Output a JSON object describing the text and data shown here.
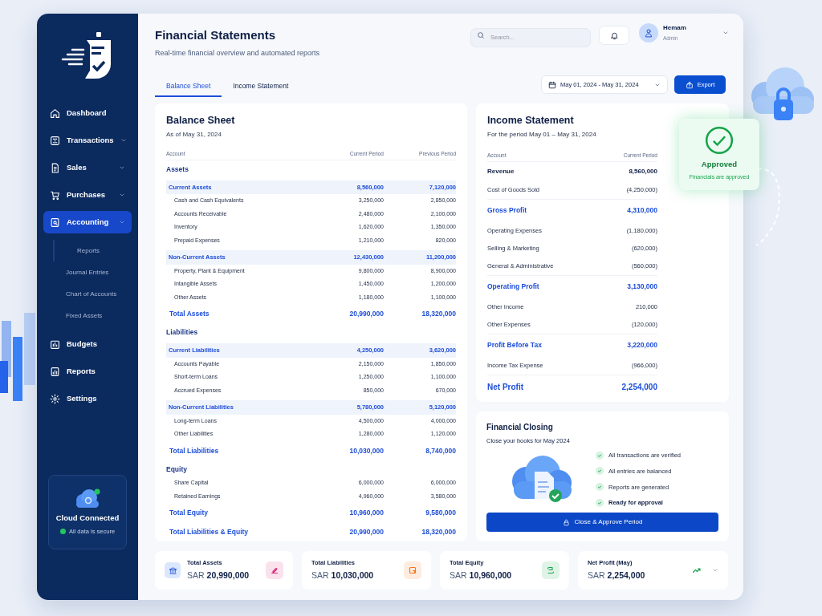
{
  "sidebar": {
    "items": [
      {
        "label": "Dashboard",
        "has_submenu": false,
        "selected": false
      },
      {
        "label": "Transactions",
        "has_submenu": true,
        "selected": false
      },
      {
        "label": "Sales",
        "has_submenu": true,
        "selected": false
      },
      {
        "label": "Purchases",
        "has_submenu": true,
        "selected": false
      },
      {
        "label": "Accounting",
        "has_submenu": true,
        "selected": true,
        "children": [
          {
            "label": "Reports",
            "selected": true
          },
          {
            "label": "Journal Entries",
            "selected": false
          },
          {
            "label": "Chart of Accounts",
            "selected": false
          },
          {
            "label": "Fixed Assets",
            "selected": false
          }
        ]
      },
      {
        "label": "Budgets",
        "has_submenu": false,
        "selected": false
      },
      {
        "label": "Reports",
        "has_submenu": false,
        "selected": false
      },
      {
        "label": "Settings",
        "has_submenu": false,
        "selected": false
      }
    ],
    "cloud": {
      "title": "Cloud Connected",
      "status": "All data is secure",
      "color": "#22c55e"
    }
  },
  "header": {
    "title": "Financial Statements",
    "subtitle": "Real-time financial overview and automated reports",
    "search": {
      "placeholder": "Search..."
    },
    "user": {
      "name": "Hemam",
      "role": "Admin"
    }
  },
  "tabs": [
    {
      "label": "Balance Sheet",
      "selected": true
    },
    {
      "label": "Income Statement",
      "selected": false
    }
  ],
  "date_range": "May 01, 2024 - May 31, 2024",
  "export_button": "Export",
  "balance_sheet": {
    "title": "Balance Sheet",
    "subtitle": "As of May 31, 2024",
    "columns": [
      "Account",
      "Current Period",
      "Previous Period"
    ],
    "rows": [
      {
        "kind": "section",
        "label": "Assets"
      },
      {
        "kind": "group",
        "label": "Current Assets",
        "current": "8,560,000",
        "previous": "7,120,000"
      },
      {
        "kind": "item",
        "label": "Cash and Cash Equivalents",
        "current": "3,250,000",
        "previous": "2,850,000"
      },
      {
        "kind": "item",
        "label": "Accounts Receivable",
        "current": "2,480,000",
        "previous": "2,100,000"
      },
      {
        "kind": "item",
        "label": "Inventory",
        "current": "1,620,000",
        "previous": "1,350,000"
      },
      {
        "kind": "item",
        "label": "Prepaid Expenses",
        "current": "1,210,000",
        "previous": "820,000"
      },
      {
        "kind": "group",
        "label": "Non-Current Assets",
        "current": "12,430,000",
        "previous": "11,200,000"
      },
      {
        "kind": "item",
        "label": "Property, Plant & Equipment",
        "current": "9,800,000",
        "previous": "8,900,000"
      },
      {
        "kind": "item",
        "label": "Intangible Assets",
        "current": "1,450,000",
        "previous": "1,200,000"
      },
      {
        "kind": "item",
        "label": "Other Assets",
        "current": "1,180,000",
        "previous": "1,100,000"
      },
      {
        "kind": "total",
        "label": "Total Assets",
        "current": "20,990,000",
        "previous": "18,320,000"
      },
      {
        "kind": "section",
        "label": "Liabilities"
      },
      {
        "kind": "group",
        "label": "Current Liabilities",
        "current": "4,250,000",
        "previous": "3,620,000"
      },
      {
        "kind": "item",
        "label": "Accounts Payable",
        "current": "2,150,000",
        "previous": "1,850,000"
      },
      {
        "kind": "item",
        "label": "Short-term Loans",
        "current": "1,250,000",
        "previous": "1,100,000"
      },
      {
        "kind": "item",
        "label": "Accrued Expenses",
        "current": "850,000",
        "previous": "670,000"
      },
      {
        "kind": "group",
        "label": "Non-Current Liabilities",
        "current": "5,780,000",
        "previous": "5,120,000"
      },
      {
        "kind": "item",
        "label": "Long-term Loans",
        "current": "4,500,000",
        "previous": "4,000,000"
      },
      {
        "kind": "item",
        "label": "Other Liabilities",
        "current": "1,280,000",
        "previous": "1,120,000"
      },
      {
        "kind": "total",
        "label": "Total Liabilities",
        "current": "10,030,000",
        "previous": "8,740,000"
      },
      {
        "kind": "section",
        "label": "Equity"
      },
      {
        "kind": "item",
        "label": "Share Capital",
        "current": "6,000,000",
        "previous": "6,000,000"
      },
      {
        "kind": "item",
        "label": "Retained Earnings",
        "current": "4,960,000",
        "previous": "3,580,000"
      },
      {
        "kind": "total",
        "label": "Total Equity",
        "current": "10,960,000",
        "previous": "9,580,000"
      },
      {
        "kind": "total",
        "label": "Total Liabilities & Equity",
        "current": "20,990,000",
        "previous": "18,320,000"
      }
    ]
  },
  "income_statement": {
    "title": "Income Statement",
    "subtitle": "For the period May 01 – May 31, 2024",
    "columns": [
      "Account",
      "Current Period"
    ],
    "rows": [
      {
        "kind": "emphasis",
        "label": "Revenue",
        "value": "8,560,000"
      },
      {
        "kind": "item",
        "label": "Cost of Goods Sold",
        "value": "(4,250,000)"
      },
      {
        "kind": "subtotal",
        "label": "Gross Profit",
        "value": "4,310,000"
      },
      {
        "kind": "item",
        "label": "Operating Expenses",
        "value": "(1,180,000)"
      },
      {
        "kind": "item",
        "label": "Selling & Marketing",
        "value": "(620,000)"
      },
      {
        "kind": "item",
        "label": "General & Administrative",
        "value": "(560,000)"
      },
      {
        "kind": "subtotal",
        "label": "Operating Profit",
        "value": "3,130,000"
      },
      {
        "kind": "item",
        "label": "Other Income",
        "value": "210,000"
      },
      {
        "kind": "item",
        "label": "Other Expenses",
        "value": "(120,000)"
      },
      {
        "kind": "subtotal",
        "label": "Profit Before Tax",
        "value": "3,220,000"
      },
      {
        "kind": "item",
        "label": "Income Tax Expense",
        "value": "(966,000)"
      },
      {
        "kind": "total",
        "label": "Net Profit",
        "value": "2,254,000"
      }
    ]
  },
  "approved": {
    "title": "Approved",
    "text": "Financials are approved"
  },
  "closing": {
    "title": "Financial Closing",
    "subtitle": "Close your books for May 2024",
    "checklist": [
      {
        "label": "All transactions are verified",
        "checked": true
      },
      {
        "label": "All entries are balanced",
        "checked": true
      },
      {
        "label": "Reports are generated",
        "checked": true
      },
      {
        "label": "Ready for approval",
        "checked": true
      }
    ],
    "button": "Close & Approve Period"
  },
  "summary": [
    {
      "label": "Total Assets",
      "currency": "SAR",
      "value": "20,990,000",
      "color": "#db2777"
    },
    {
      "label": "Total Liabilities",
      "currency": "SAR",
      "value": "10,030,000",
      "color": "#f97316"
    },
    {
      "label": "Total Equity",
      "currency": "SAR",
      "value": "10,960,000",
      "color": "#16a34a"
    },
    {
      "label": "Net Profit (May)",
      "currency": "SAR",
      "value": "2,254,000",
      "color": "#16a34a"
    }
  ]
}
